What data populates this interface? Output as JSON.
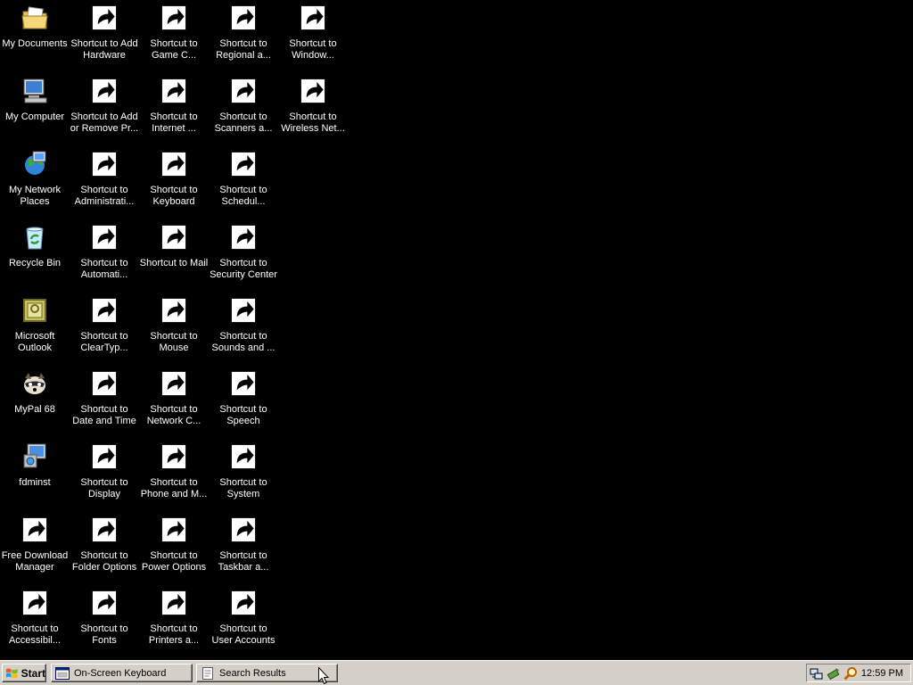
{
  "desktop": {
    "icons": [
      {
        "label": "My Documents",
        "icon": "folder-documents-icon",
        "shortcut": false
      },
      {
        "label": "My Computer",
        "icon": "computer-icon",
        "shortcut": false
      },
      {
        "label": "My Network Places",
        "icon": "network-places-icon",
        "shortcut": false
      },
      {
        "label": "Recycle Bin",
        "icon": "recycle-bin-icon",
        "shortcut": false
      },
      {
        "label": "Microsoft Outlook",
        "icon": "outlook-icon",
        "shortcut": false
      },
      {
        "label": "MyPal 68",
        "icon": "raccoon-icon",
        "shortcut": false
      },
      {
        "label": "fdminst",
        "icon": "installer-icon",
        "shortcut": false
      },
      {
        "label": "Free Download Manager",
        "icon": "download-manager-icon",
        "shortcut": true
      },
      {
        "label": "Shortcut to Accessibil...",
        "icon": "accessibility-icon",
        "shortcut": true
      },
      {
        "label": "Shortcut to Add Hardware",
        "icon": "add-hardware-icon",
        "shortcut": true
      },
      {
        "label": "Shortcut to Add or Remove Pr...",
        "icon": "add-remove-programs-icon",
        "shortcut": true
      },
      {
        "label": "Shortcut to Administrati...",
        "icon": "administrative-tools-icon",
        "shortcut": true
      },
      {
        "label": "Shortcut to Automati...",
        "icon": "windows-flag-icon",
        "shortcut": true
      },
      {
        "label": "Shortcut to ClearTyp...",
        "icon": "cleartype-icon",
        "shortcut": true
      },
      {
        "label": "Shortcut to Date and Time",
        "icon": "clock-icon",
        "shortcut": true
      },
      {
        "label": "Shortcut to Display",
        "icon": "display-icon",
        "shortcut": true
      },
      {
        "label": "Shortcut to Folder Options",
        "icon": "folder-options-icon",
        "shortcut": true
      },
      {
        "label": "Shortcut to Fonts",
        "icon": "fonts-folder-icon",
        "shortcut": true
      },
      {
        "label": "Shortcut to Game C...",
        "icon": "game-controller-icon",
        "shortcut": true
      },
      {
        "label": "Shortcut to Internet ...",
        "icon": "internet-options-icon",
        "shortcut": true
      },
      {
        "label": "Shortcut to Keyboard",
        "icon": "keyboard-icon",
        "shortcut": true
      },
      {
        "label": "Shortcut to Mail",
        "icon": "mail-icon",
        "shortcut": true
      },
      {
        "label": "Shortcut to Mouse",
        "icon": "mouse-icon",
        "shortcut": true
      },
      {
        "label": "Shortcut to Network C...",
        "icon": "network-connections-icon",
        "shortcut": true
      },
      {
        "label": "Shortcut to Phone and M...",
        "icon": "phone-modem-icon",
        "shortcut": true
      },
      {
        "label": "Shortcut to Power Options",
        "icon": "power-options-icon",
        "shortcut": true
      },
      {
        "label": "Shortcut to Printers a...",
        "icon": "printer-icon",
        "shortcut": true
      },
      {
        "label": "Shortcut to Regional a...",
        "icon": "globe-icon",
        "shortcut": true
      },
      {
        "label": "Shortcut to Scanners a...",
        "icon": "scanner-camera-icon",
        "shortcut": true
      },
      {
        "label": "Shortcut to Schedul...",
        "icon": "scheduled-tasks-icon",
        "shortcut": true
      },
      {
        "label": "Shortcut to Security Center",
        "icon": "security-shield-icon",
        "shortcut": true
      },
      {
        "label": "Shortcut to Sounds and ...",
        "icon": "speaker-icon",
        "shortcut": true
      },
      {
        "label": "Shortcut to Speech",
        "icon": "speech-icon",
        "shortcut": true
      },
      {
        "label": "Shortcut to System",
        "icon": "system-icon",
        "shortcut": true
      },
      {
        "label": "Shortcut to Taskbar a...",
        "icon": "taskbar-icon",
        "shortcut": true
      },
      {
        "label": "Shortcut to User Accounts",
        "icon": "user-accounts-icon",
        "shortcut": true
      },
      {
        "label": "Shortcut to Window...",
        "icon": "firewall-icon",
        "shortcut": true
      },
      {
        "label": "Shortcut to Wireless Net...",
        "icon": "wireless-network-icon",
        "shortcut": true
      }
    ]
  },
  "taskbar": {
    "start_label": "Start",
    "tasks": [
      {
        "label": "On-Screen Keyboard",
        "icon": "keyboard-window-icon"
      },
      {
        "label": "Search Results",
        "icon": "search-results-icon"
      }
    ],
    "tray_icons": [
      "network-tray-icon",
      "safely-remove-icon",
      "search-tray-icon"
    ],
    "clock": "12:59 PM"
  },
  "colors": {
    "desktop_bg": "#000000",
    "taskbar_bg": "#d4d0c8",
    "label_text": "#ffffff"
  }
}
